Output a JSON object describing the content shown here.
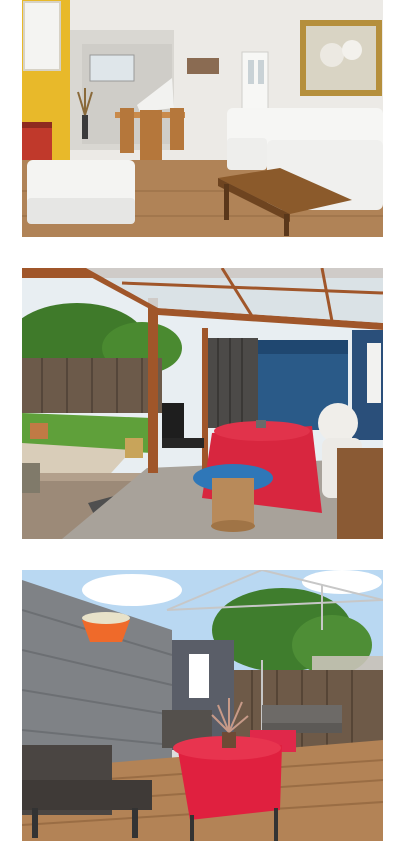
{
  "gallery": {
    "photos": [
      {
        "subject": "living-room-with-dining-area"
      },
      {
        "subject": "covered-patio-with-red-table"
      },
      {
        "subject": "decking-garden-with-furniture"
      }
    ]
  },
  "colors": {
    "background": "#ffffff",
    "accent_red": "#d8263f",
    "wood": "#a86a3c",
    "sky": "#b9d8f2"
  }
}
